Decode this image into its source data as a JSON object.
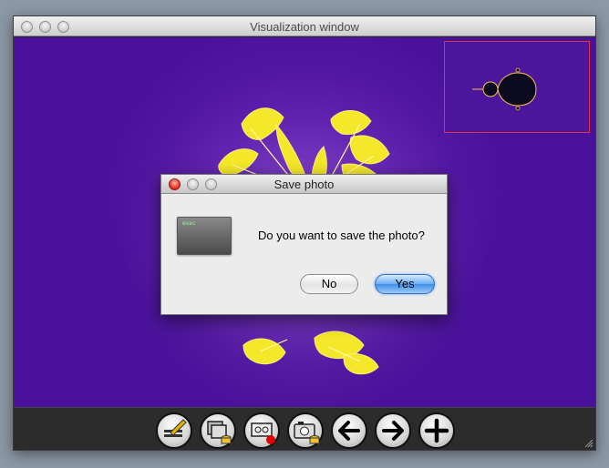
{
  "window": {
    "title": "Visualization window",
    "controls": [
      "close",
      "minimize",
      "zoom"
    ]
  },
  "dialog": {
    "title": "Save photo",
    "message": "Do you want to save the photo?",
    "icon": "terminal-icon",
    "icon_text": "exec",
    "buttons": {
      "no": "No",
      "yes": "Yes"
    },
    "default_button": "yes"
  },
  "toolbar": {
    "tools": [
      "draw-icon",
      "layers-save-icon",
      "record-icon",
      "camera-save-icon",
      "arrow-left-icon",
      "arrow-right-icon",
      "plus-icon"
    ]
  },
  "colors": {
    "background_purple": "#4a129a",
    "fractal_yellow": "#f5e82a",
    "minimap_border": "#e0304a",
    "default_button_blue": "#4f9ae9"
  }
}
